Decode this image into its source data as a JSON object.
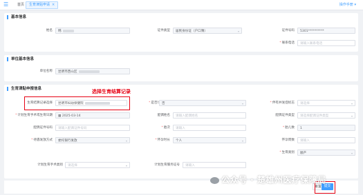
{
  "topbar": {
    "menu_icon": "hamburger-icon",
    "tab_home": "首页",
    "tab_active": "生育津贴申请",
    "tab_close": "×",
    "manual": "操作手册 ▾"
  },
  "basic": {
    "title": "基本信息",
    "name_label": "姓名",
    "name_value": "韩",
    "id_type_label": "证件类型",
    "id_type_value": "居民身份证（户口簿）",
    "id_no_label": "证件号码",
    "id_no_value": "5301**********",
    "phone_label": "联系电话",
    "phone_placeholder": "请输入联系电话"
  },
  "unit": {
    "title": "单位基本信息",
    "unit_name_label": "单位名称",
    "unit_name_value": "昆明市西山区"
  },
  "apply": {
    "title": "生育津贴申报信息",
    "annotation": "选择生育结算记录",
    "settle_label": "生育结算记录选择",
    "settle_value": "昆明市妇幼保健院",
    "plan_label": "是否计划生育",
    "plan_value": "否",
    "fake_label": "伴有并发症标志",
    "fake_placeholder": "请选择",
    "surgery_date_label": "计划生育手术或生育日期",
    "surgery_date_value": "2025-03-14",
    "spouse_name_label": "配偶姓名",
    "spouse_name_placeholder": "请输入配偶姓名",
    "spouse_id_type_label": "配偶证件类型",
    "spouse_id_type_placeholder": "请选择配偶证件类型",
    "spouse_id_no_label": "配偶证件号码",
    "spouse_id_no_placeholder": "请输入配偶证件号码",
    "parity_label": "胎次",
    "parity_placeholder": "请输入",
    "fetus_label": "胎儿数",
    "fetus_value": "1",
    "pay_label": "待遇发放方式",
    "pay_value": "委托银行发放",
    "weeks_label": "怀孕时长",
    "weeks_value": "个人",
    "pregnancy_label": "怀孕周数",
    "pregnancy_placeholder": "请输入",
    "category_label": "生育类别",
    "category_value": "顺产",
    "op_type_label": "计划生育手术类别",
    "op_type_placeholder": "请选择",
    "service_no_label": "计划生育服务证号",
    "service_no_placeholder": "请输入"
  },
  "footer": {
    "reset": "重置",
    "submit": "提交"
  },
  "watermark": "公众号 · 楚雄州医疗保障局",
  "colors": {
    "primary": "#409eff",
    "annotation": "#e60012"
  }
}
